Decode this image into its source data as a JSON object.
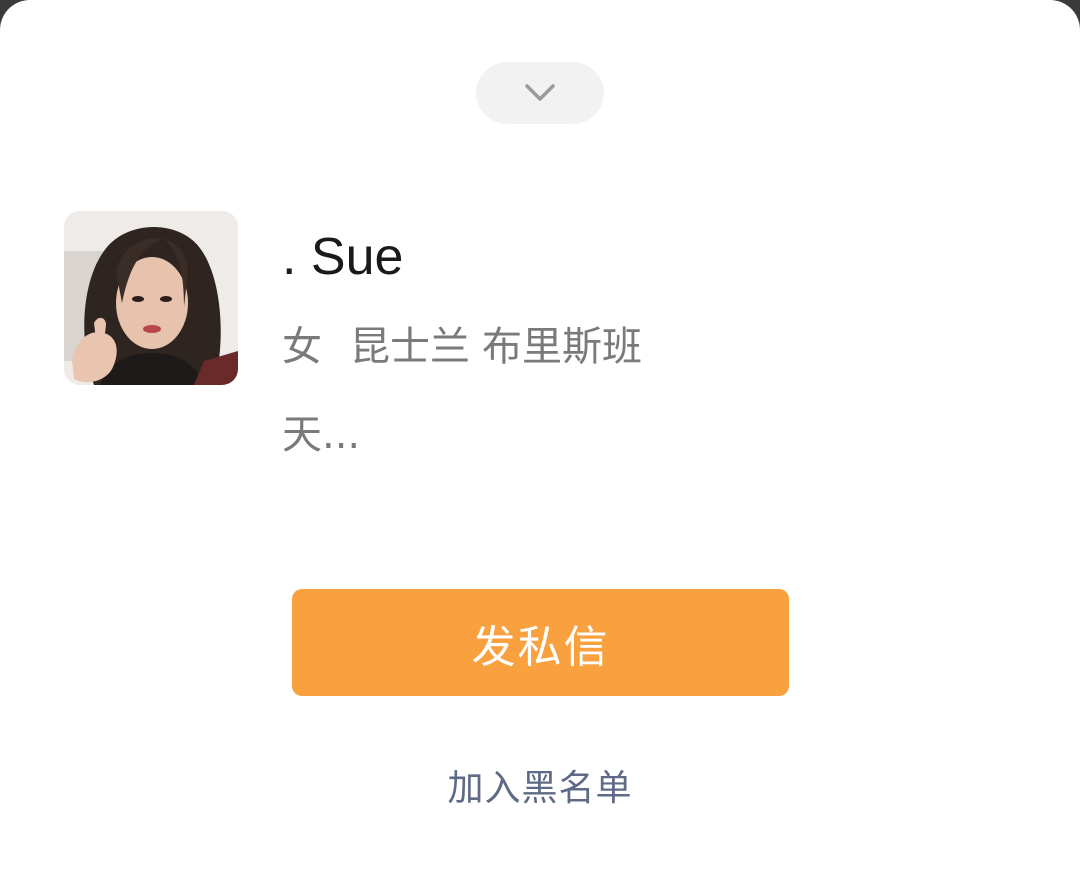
{
  "sheet": {
    "collapse_icon": "chevron-down-icon"
  },
  "profile": {
    "avatar_icon": "user-photo",
    "name": ". Sue",
    "gender": "女",
    "province": "昆士兰",
    "city": "布里斯班",
    "bio": "天..."
  },
  "actions": {
    "message_label": "发私信",
    "blacklist_label": "加入黑名单"
  },
  "colors": {
    "accent": "#f9a13e",
    "link": "#5f6a86",
    "secondary_text": "#7a7a7a"
  }
}
